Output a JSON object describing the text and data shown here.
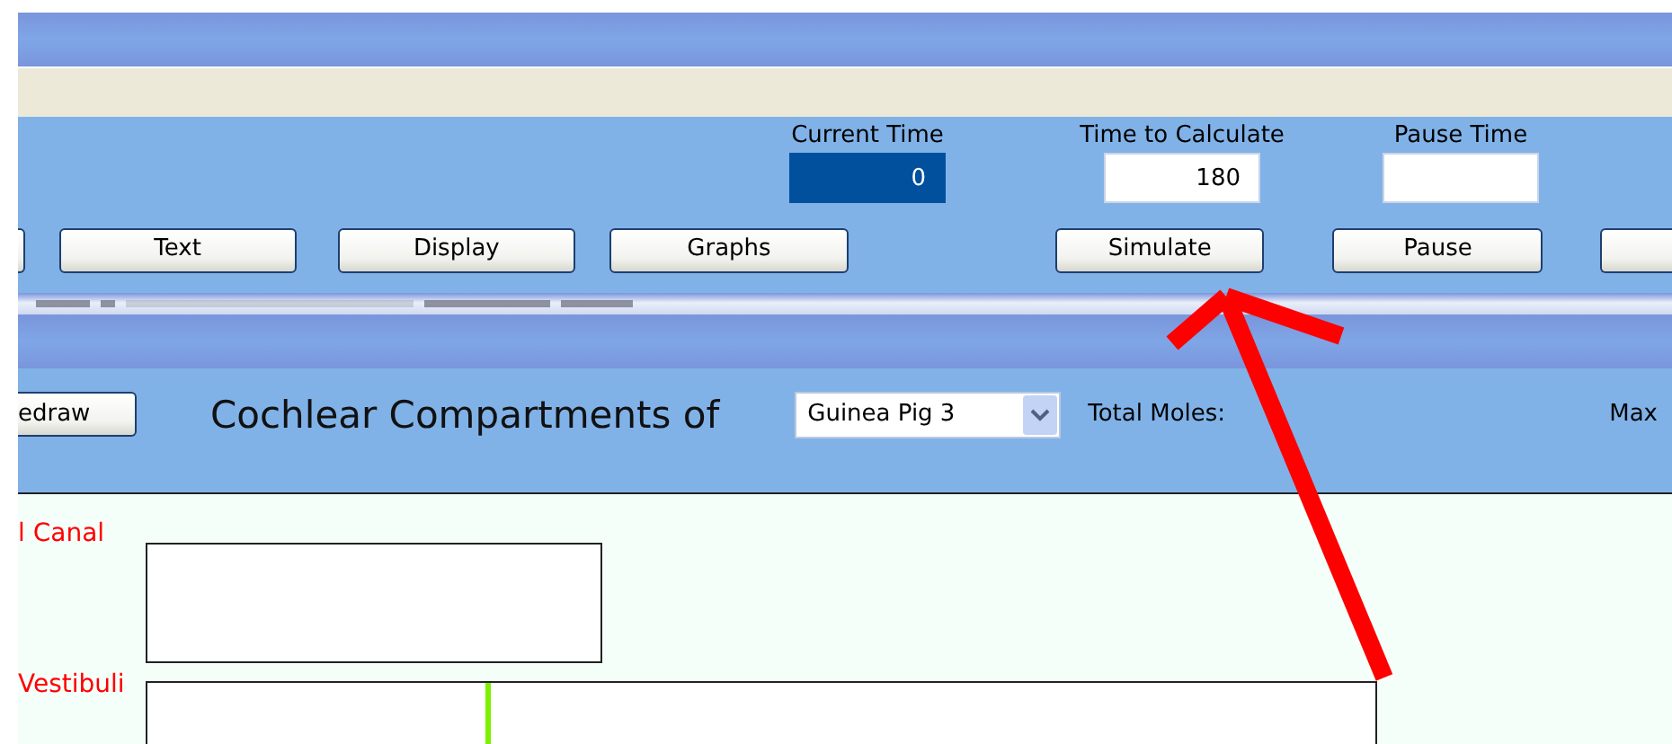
{
  "time_fields": [
    {
      "label": "Current Time",
      "value": "0",
      "kind": "readout"
    },
    {
      "label": "Time to Calculate",
      "value": "180",
      "kind": "input"
    },
    {
      "label": "Pause Time",
      "kind": "input"
    }
  ],
  "buttons": [
    {
      "kind": "cut"
    },
    {
      "label": "Text"
    },
    {
      "label": "Display"
    },
    {
      "label": "Graphs"
    },
    {
      "label": "Simulate"
    },
    {
      "label": "Pause"
    },
    {
      "kind": "cut"
    }
  ],
  "compartment_bar": {
    "redraw_button": "edraw",
    "title": "Cochlear Compartments of",
    "animal_select": "Guinea Pig 3",
    "total_moles_label": "Total Moles:",
    "max_label": "Max"
  },
  "compartments": [
    {
      "label": "l Canal"
    },
    {
      "label": "Vestibuli"
    }
  ]
}
